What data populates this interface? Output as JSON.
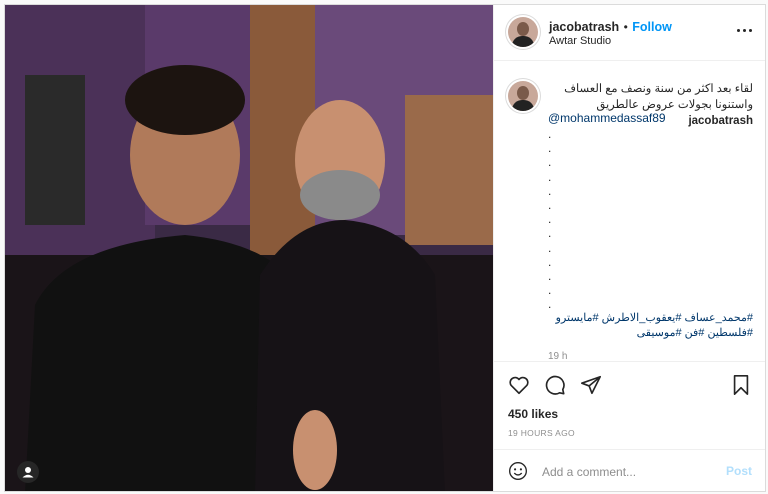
{
  "header": {
    "username": "jacobatrash",
    "separator": "•",
    "follow_label": "Follow",
    "location": "Awtar Studio"
  },
  "caption": {
    "username": "jacobatrash",
    "text": "لقاء بعد اكثر من سنة ونصف مع العساف واستنونا بجولات عروض عالطريق",
    "mention": "@mohammedassaf89",
    "dots": [
      ".",
      ".",
      ".",
      ".",
      ".",
      ".",
      ".",
      ".",
      ".",
      ".",
      ".",
      ".",
      "."
    ],
    "hashtags": "#محمد_عساف #يعقوب_الاطرش #مايسترو #فلسطين #فن #موسيقى",
    "time": "19 h"
  },
  "actions": {
    "likes": "450 likes",
    "posted_ago": "19 HOURS AGO"
  },
  "comment_box": {
    "placeholder": "Add a comment...",
    "post_label": "Post"
  },
  "icons": [
    "heart-icon",
    "comment-icon",
    "share-icon",
    "bookmark-icon",
    "more-icon",
    "emoji-icon",
    "user-tag-icon"
  ],
  "colors": {
    "accent": "#0095f6",
    "link": "#00376b",
    "muted": "#8e8e8e",
    "post_disabled": "#b2dffc"
  }
}
